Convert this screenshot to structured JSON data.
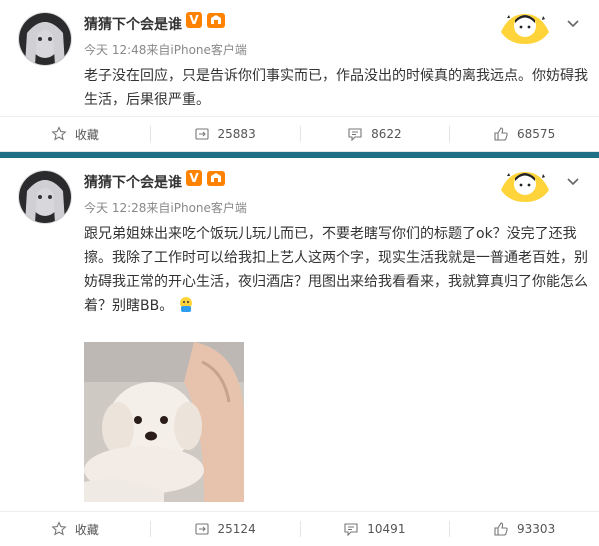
{
  "posts": [
    {
      "username": "猜猜下个会是谁",
      "meta": "今天 12:48来自iPhone客户端",
      "content": "老子没在回应，只是告诉你们事实而已，作品没出的时候真的离我远点。你妨碍我生活，后果很严重。",
      "actions": {
        "favorite": "收藏",
        "repost": "25883",
        "comment": "8622",
        "like": "68575"
      }
    },
    {
      "username": "猜猜下个会是谁",
      "meta": "今天 12:28来自iPhone客户端",
      "content": "跟兄弟姐妹出来吃个饭玩儿玩儿而已，不要老瞎写你们的标题了ok？没完了还我擦。我除了工作时可以给我扣上艺人这两个字，现实生活我就是一普通老百姓，别妨碍我正常的开心生活，夜归酒店？甩图出来给我看看来，我就算真归了你能怎么着？别瞎BB。",
      "actions": {
        "favorite": "收藏",
        "repost": "25124",
        "comment": "10491",
        "like": "93303"
      }
    }
  ],
  "icons": {
    "verify": "V",
    "favorite_icon": "star-outline-icon",
    "repost_icon": "repost-icon",
    "comment_icon": "comment-icon",
    "like_icon": "thumbs-up-icon"
  },
  "colors": {
    "divider": "#1f6f87",
    "verify": "#ff8200",
    "text": "#333333",
    "meta": "#888888"
  }
}
